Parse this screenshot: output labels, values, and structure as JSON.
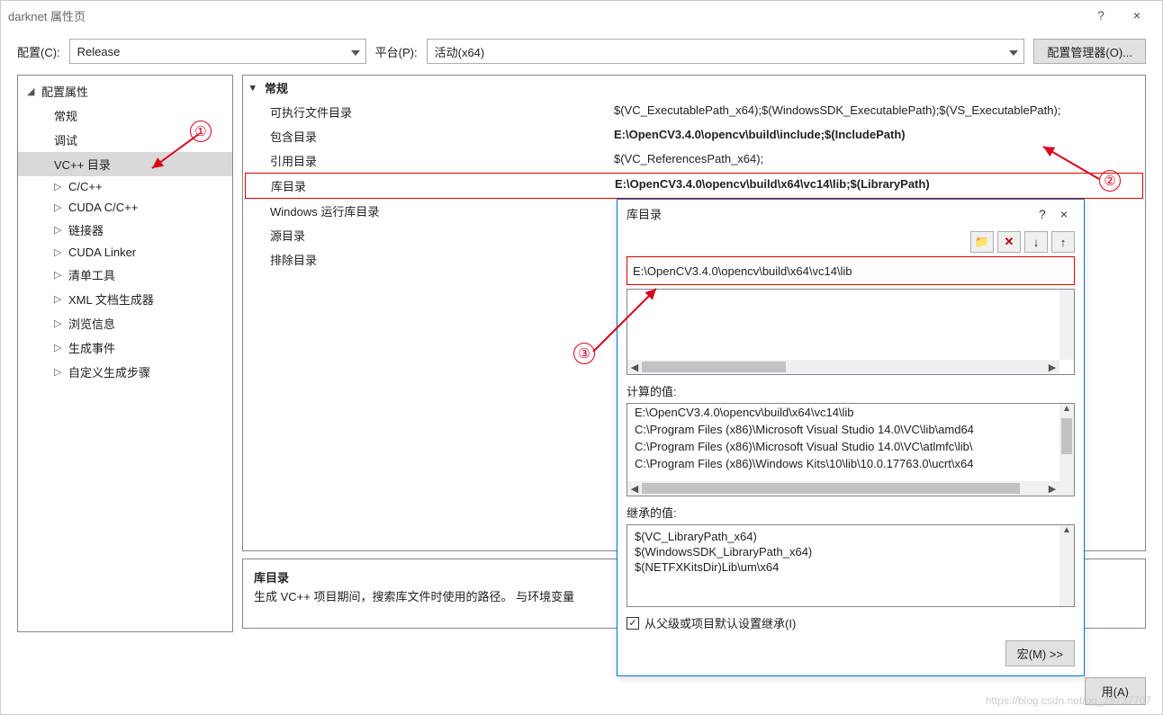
{
  "window": {
    "title": "darknet 属性页",
    "help": "?",
    "close": "×"
  },
  "config": {
    "label_config": "配置(C):",
    "config_value": "Release",
    "label_platform": "平台(P):",
    "platform_value": "活动(x64)",
    "manager_btn": "配置管理器(O)..."
  },
  "tree": {
    "root": "配置属性",
    "items": [
      "常规",
      "调试",
      "VC++ 目录",
      "C/C++",
      "CUDA C/C++",
      "链接器",
      "CUDA Linker",
      "清单工具",
      "XML 文档生成器",
      "浏览信息",
      "生成事件",
      "自定义生成步骤"
    ],
    "selected_index": 2
  },
  "grid": {
    "header": "常规",
    "rows": [
      {
        "k": "可执行文件目录",
        "v": "$(VC_ExecutablePath_x64);$(WindowsSDK_ExecutablePath);$(VS_ExecutablePath);"
      },
      {
        "k": "包含目录",
        "v": "E:\\OpenCV3.4.0\\opencv\\build\\include;$(IncludePath)",
        "bold": true
      },
      {
        "k": "引用目录",
        "v": "$(VC_ReferencesPath_x64);"
      },
      {
        "k": "库目录",
        "v": "E:\\OpenCV3.4.0\\opencv\\build\\x64\\vc14\\lib;$(LibraryPath)",
        "hl": true
      },
      {
        "k": "Windows 运行库目录",
        "v": ""
      },
      {
        "k": "源目录",
        "v": ""
      },
      {
        "k": "排除目录",
        "v": ""
      }
    ]
  },
  "desc": {
    "title": "库目录",
    "text": "生成 VC++ 项目期间，搜索库文件时使用的路径。    与环境变量"
  },
  "bottom": {
    "apply_rhs": "用(A)"
  },
  "popup": {
    "title": "库目录",
    "help": "?",
    "close": "×",
    "toolbar": {
      "new": "📁",
      "delete": "✕",
      "down": "↓",
      "up": "↑"
    },
    "edit_value": "E:\\OpenCV3.4.0\\opencv\\build\\x64\\vc14\\lib",
    "evaluated_label": "计算的值:",
    "evaluated": [
      "E:\\OpenCV3.4.0\\opencv\\build\\x64\\vc14\\lib",
      "C:\\Program Files (x86)\\Microsoft Visual Studio 14.0\\VC\\lib\\amd64",
      "C:\\Program Files (x86)\\Microsoft Visual Studio 14.0\\VC\\atlmfc\\lib\\",
      "C:\\Program Files (x86)\\Windows Kits\\10\\lib\\10.0.17763.0\\ucrt\\x64"
    ],
    "inherited_label": "继承的值:",
    "inherited": [
      "$(VC_LibraryPath_x64)",
      "$(WindowsSDK_LibraryPath_x64)",
      "$(NETFXKitsDir)Lib\\um\\x64"
    ],
    "inherit_checkbox": "从父级或项目默认设置继承(I)",
    "macro_btn": "宏(M) >>"
  },
  "annotations": {
    "one": "①",
    "two": "②",
    "three": "③"
  },
  "watermark": "https://blog.csdn.net/qq_28737707"
}
